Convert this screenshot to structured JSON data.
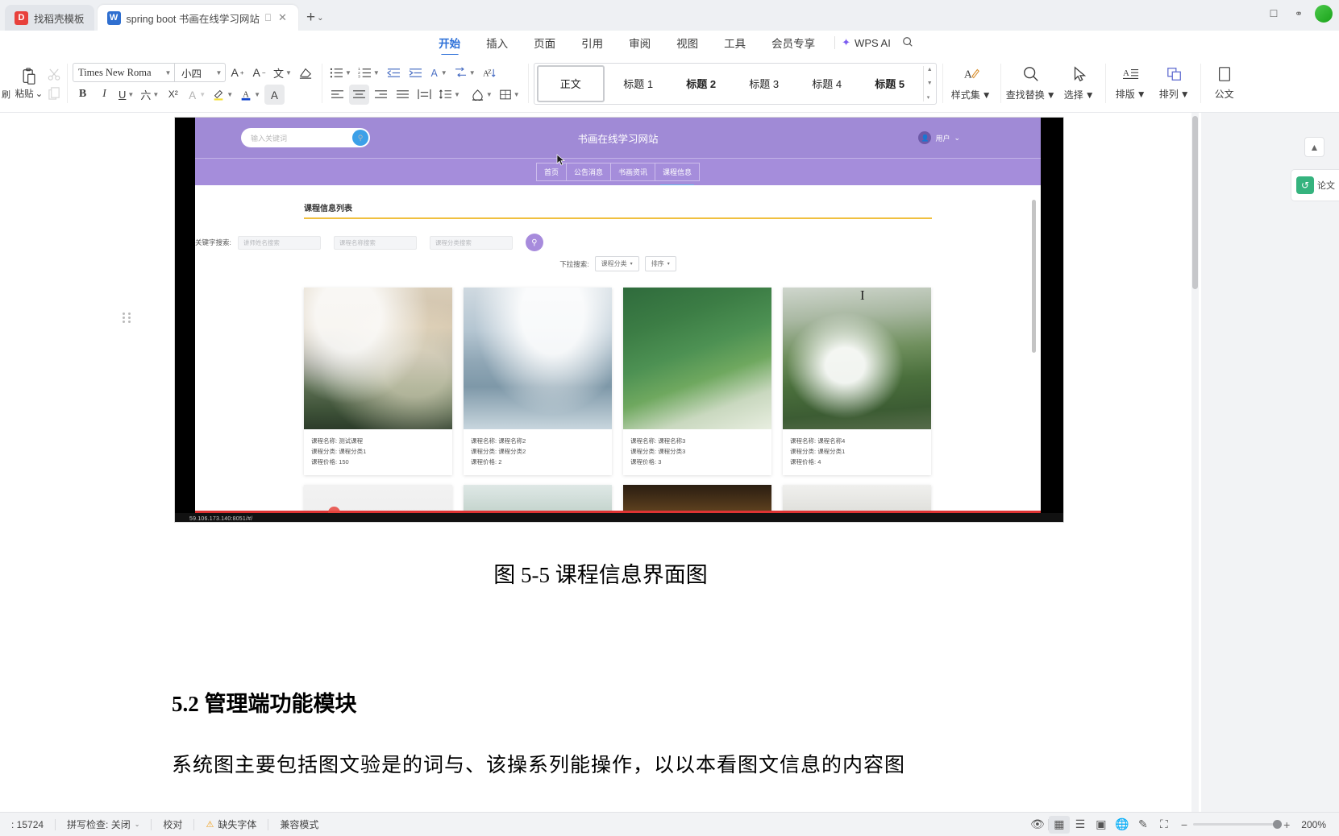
{
  "window": {
    "tabs": [
      {
        "label": "找稻壳模板",
        "icon": "docer-icon",
        "badge": "D",
        "active": false
      },
      {
        "label": "spring boot 书画在线学习网站",
        "icon": "wps-writer-icon",
        "badge": "W",
        "active": true
      }
    ],
    "new_tab_label": "+",
    "new_tab_caret": "⌄",
    "right_icons": [
      "window-restore-icon",
      "shield-icon",
      "user-avatar"
    ]
  },
  "menubar": {
    "items": [
      "开始",
      "插入",
      "页面",
      "引用",
      "审阅",
      "视图",
      "工具",
      "会员专享"
    ],
    "active": "开始",
    "ai_label": "WPS AI",
    "search_icon": "search-icon"
  },
  "ribbon": {
    "clipboard": {
      "cut_icon": "scissors-icon",
      "paste_label": "粘贴",
      "paste_caret": "⌄",
      "copy_icon": "copy-icon",
      "format_painter_label": "刷"
    },
    "font": {
      "name": "Times New Roma",
      "size": "小四",
      "grow_icon": "increase-font-icon",
      "shrink_icon": "decrease-font-icon",
      "pinyin_icon": "pinyin-guide-icon",
      "clear_format_icon": "clear-format-icon",
      "bold": "B",
      "italic": "I",
      "underline": "U",
      "strikethrough_icon": "strikethrough-icon",
      "superscript": "X²",
      "char_border_icon": "character-border-icon",
      "highlight_icon": "highlight-color-icon",
      "fontcolor_icon": "font-color-icon",
      "char_shading_icon": "character-shading-icon"
    },
    "paragraph": {
      "bullets_icon": "bullet-list-icon",
      "numbering_icon": "numbered-list-icon",
      "outdent_icon": "decrease-indent-icon",
      "indent_icon": "increase-indent-icon",
      "asian_layout_icon": "asian-layout-icon",
      "show_marks_icon": "show-formatting-marks-icon",
      "sort_icon": "sort-icon",
      "align_left_icon": "align-left-icon",
      "align_center_icon": "align-center-icon",
      "align_right_icon": "align-right-icon",
      "justify_icon": "justify-icon",
      "distribute_icon": "distributed-align-icon",
      "line_spacing_icon": "line-spacing-icon",
      "shading_icon": "paragraph-shading-icon",
      "borders_icon": "borders-icon"
    },
    "styles": {
      "items": [
        "正文",
        "标题 1",
        "标题 2",
        "标题 3",
        "标题 4",
        "标题 5"
      ],
      "selected": "正文",
      "styleset_label": "样式集",
      "styleset_caret": "⌄"
    },
    "editing": {
      "find_label": "查找替换",
      "find_icon": "search-icon",
      "select_label": "选择",
      "select_icon": "cursor-select-icon",
      "typeset_label": "排版",
      "typeset_icon": "typeset-icon",
      "arrange_label": "排列",
      "arrange_icon": "arrange-objects-icon",
      "formula_label": "公文",
      "formula_icon": "document-icon"
    }
  },
  "document": {
    "caption": "图 5-5 课程信息界面图",
    "heading": "5.2 管理端功能模块",
    "body_text": "系统图主要包括图文验是的词与、该操系列能操作，以以本看图文信息的内容图"
  },
  "embedded_site": {
    "search_placeholder": "输入关键词",
    "search_icon": "search-icon",
    "site_title": "书画在线学习网站",
    "user_label": "用户",
    "user_caret": "⌄",
    "nav": [
      "首页",
      "公告消息",
      "书画资讯",
      "课程信息"
    ],
    "nav_active": "课程信息",
    "panel_title": "课程信息列表",
    "filter_label": "关键字搜索:",
    "filter_inputs": [
      "讲师姓名搜索",
      "课程名称搜索",
      "课程分类搜索"
    ],
    "dropdown_label": "下拉搜索:",
    "dropdowns": [
      "课程分类",
      "排序"
    ],
    "dropdown_caret": "▾",
    "cards": [
      {
        "name_label": "课程名称:",
        "name": "测试课程",
        "category_label": "课程分类:",
        "category": "课程分类1",
        "price_label": "课程价格:",
        "price": "150",
        "art": "p1"
      },
      {
        "name_label": "课程名称:",
        "name": "课程名称2",
        "category_label": "课程分类:",
        "category": "课程分类2",
        "price_label": "课程价格:",
        "price": "2",
        "art": "p2"
      },
      {
        "name_label": "课程名称:",
        "name": "课程名称3",
        "category_label": "课程分类:",
        "category": "课程分类3",
        "price_label": "课程价格:",
        "price": "3",
        "art": "p3"
      },
      {
        "name_label": "课程名称:",
        "name": "课程名称4",
        "category_label": "课程分类:",
        "category": "课程分类1",
        "price_label": "课程价格:",
        "price": "4",
        "art": "p4"
      }
    ],
    "row2_art": [
      "p5",
      "p6",
      "p7",
      "p8"
    ],
    "url": "59.106.173.140:8051/#/"
  },
  "rail": {
    "collapse_icon": "collapse-panel-icon",
    "badge_icon": "essay-check-icon",
    "badge_label": "论文"
  },
  "statusbar": {
    "word_count": ": 15724",
    "spellcheck": "拼写检查: 关闭",
    "spellcheck_caret": "⌄",
    "proofread": "校对",
    "missing_font": "缺失字体",
    "missing_font_icon": "warning-icon",
    "compat_mode": "兼容模式",
    "zoom": "200%",
    "view_icons": [
      "eye-icon",
      "page-view-icon",
      "outline-view-icon",
      "web-view-icon",
      "globe-icon",
      "pen-icon",
      "fullscreen-icon"
    ]
  }
}
